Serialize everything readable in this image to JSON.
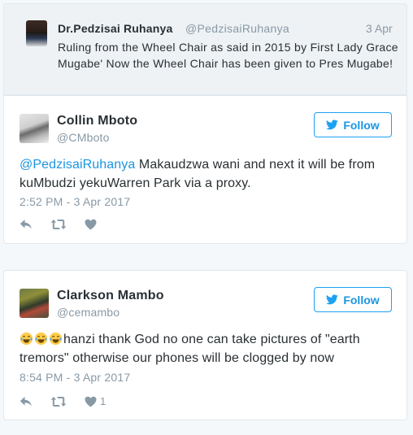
{
  "quoted_tweet": {
    "name": "Dr.Pedzisai Ruhanya",
    "handle": "@PedzisaiRuhanya",
    "date": "3 Apr",
    "text": "Ruling from the Wheel Chair as said in 2015 by First Lady Grace Mugabe' Now the Wheel Chair has been given to Pres Mugabe!"
  },
  "replies": [
    {
      "name": "Collin Mboto",
      "handle": "@CMboto",
      "follow_label": "Follow",
      "mention": "@PedzisaiRuhanya",
      "text": " Makaudzwa wani and next it will be from kuMbudzi yekuWarren Park via a proxy.",
      "timestamp": "2:52 PM - 3 Apr 2017",
      "like_count": ""
    },
    {
      "name": "Clarkson Mambo",
      "handle": "@cemambo",
      "follow_label": "Follow",
      "emoji": "😂😂😂",
      "text": "hanzi thank God no one can take pictures of \"earth tremors\" otherwise our phones will be clogged by now",
      "timestamp": "8:54 PM - 3 Apr 2017",
      "like_count": "1"
    }
  ],
  "icons": {
    "reply": "reply-icon",
    "retweet": "retweet-icon",
    "like": "heart-icon",
    "bird": "twitter-bird-icon"
  },
  "colors": {
    "link": "#1b95e0",
    "muted": "#8899a6",
    "text": "#292f33",
    "quoted_bg": "#eef2f5"
  }
}
